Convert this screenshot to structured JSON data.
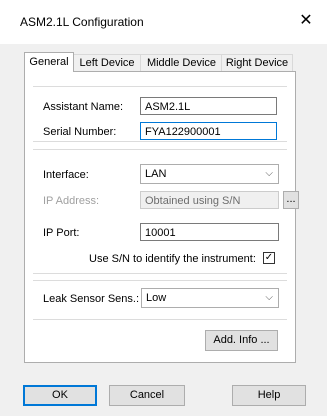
{
  "window": {
    "title": "ASM2.1L Configuration",
    "close_glyph": "✕"
  },
  "tabs": [
    {
      "label": "General",
      "active": true
    },
    {
      "label": "Left Device"
    },
    {
      "label": "Middle Device"
    },
    {
      "label": "Right Device"
    }
  ],
  "general": {
    "assistant_name_label": "Assistant Name:",
    "assistant_name_value": "ASM2.1L",
    "serial_number_label": "Serial Number:",
    "serial_number_value": "FYA122900001",
    "interface_label": "Interface:",
    "interface_value": "LAN",
    "ip_address_label": "IP Address:",
    "ip_address_value": "Obtained using S/N",
    "ip_address_button": "...",
    "ip_port_label": "IP Port:",
    "ip_port_value": "10001",
    "use_sn_label": "Use S/N to identify the instrument:",
    "use_sn_checked": "✓",
    "leak_sensor_label": "Leak Sensor Sens.:",
    "leak_sensor_value": "Low",
    "add_info_button": "Add. Info ...",
    "chevron": "⌵"
  },
  "footer": {
    "ok_label": "OK",
    "cancel_label": "Cancel",
    "help_label": "Help"
  },
  "colors": {
    "focus": "#0078d7",
    "panel": "#ffffff",
    "window": "#f0f0f0"
  }
}
